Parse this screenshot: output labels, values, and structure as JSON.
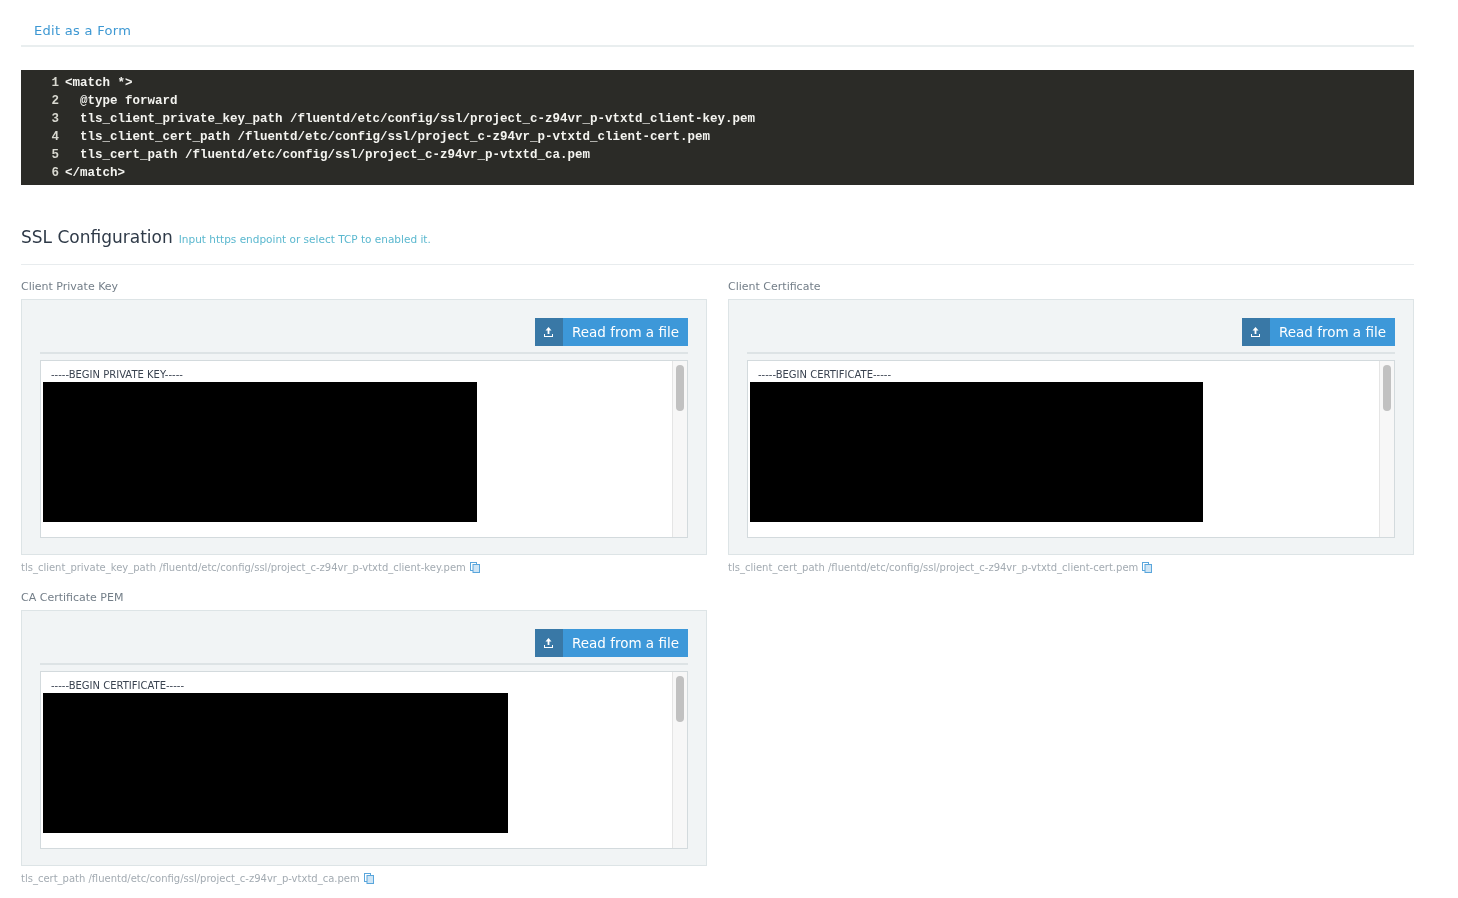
{
  "edit_link": "Edit as a Form",
  "code_lines": [
    {
      "number": "1",
      "text": "<match *>"
    },
    {
      "number": "2",
      "text": "  @type forward"
    },
    {
      "number": "3",
      "text": "  tls_client_private_key_path /fluentd/etc/config/ssl/project_c-z94vr_p-vtxtd_client-key.pem"
    },
    {
      "number": "4",
      "text": "  tls_client_cert_path /fluentd/etc/config/ssl/project_c-z94vr_p-vtxtd_client-cert.pem"
    },
    {
      "number": "5",
      "text": "  tls_cert_path /fluentd/etc/config/ssl/project_c-z94vr_p-vtxtd_ca.pem"
    },
    {
      "number": "6",
      "text": "</match>"
    }
  ],
  "ssl": {
    "title": "SSL Configuration",
    "hint": "Input https endpoint or select TCP to enabled it.",
    "fields": [
      {
        "label": "Client Private Key",
        "button": "Read from a file",
        "value": "-----BEGIN PRIVATE KEY-----",
        "path": "tls_client_private_key_path /fluentd/etc/config/ssl/project_c-z94vr_p-vtxtd_client-key.pem"
      },
      {
        "label": "Client Certificate",
        "button": "Read from a file",
        "value": "-----BEGIN CERTIFICATE-----",
        "path": "tls_client_cert_path /fluentd/etc/config/ssl/project_c-z94vr_p-vtxtd_client-cert.pem"
      },
      {
        "label": "CA Certificate PEM",
        "button": "Read from a file",
        "value": "-----BEGIN CERTIFICATE-----",
        "path": "tls_cert_path /fluentd/etc/config/ssl/project_c-z94vr_p-vtxtd_ca.pem"
      }
    ]
  }
}
